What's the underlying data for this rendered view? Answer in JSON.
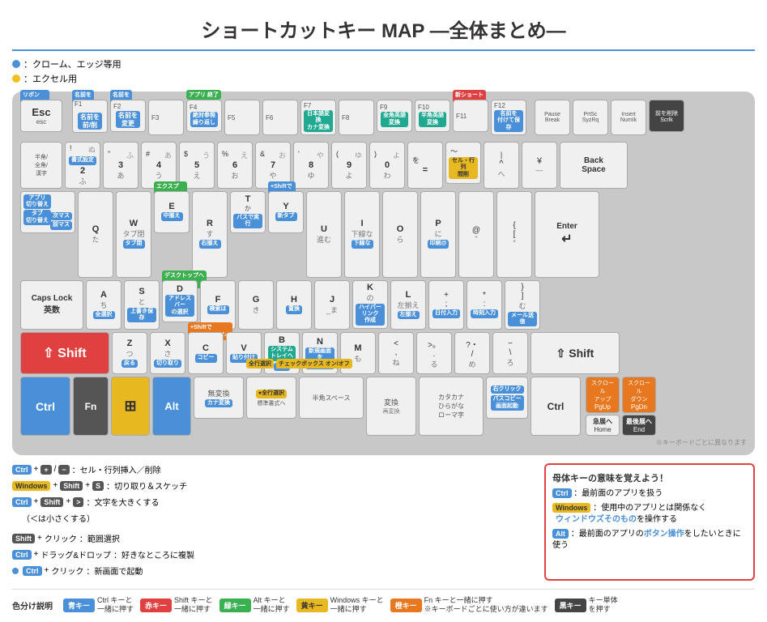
{
  "title": "ショートカットキー MAP ―全体まとめ―",
  "legend": {
    "blue": "：クローム、エッジ等用",
    "yellow": "：エクセル用"
  },
  "keyboard": {
    "note": "※キーボードごとに異なります"
  },
  "shortcuts": [
    {
      "keys": [
        "Ctrl",
        "+",
        "+",
        "/",
        "−"
      ],
      "desc": "：セル・行列挿入／削除"
    },
    {
      "keys": [
        "Windows",
        "+",
        "Shift",
        "+",
        "S"
      ],
      "desc": "：切り取り＆スケッチ"
    },
    {
      "keys": [
        "Ctrl",
        "+",
        "Shift",
        "+",
        ">"
      ],
      "desc": "：文字を大きくする（＜は小さくする）"
    },
    {
      "keys": [
        "Shift",
        "+",
        "クリック"
      ],
      "desc": "：範囲選択"
    },
    {
      "keys": [
        "Ctrl",
        "+",
        "ドラッグ&ドロップ"
      ],
      "desc": "：好きなところに複製"
    },
    {
      "keys": [
        "Ctrl",
        "+",
        "クリック"
      ],
      "desc": "：新画面で起動"
    }
  ],
  "infoBox": {
    "title": "母体キーの意味を覚えよう！",
    "rows": [
      {
        "key": "Ctrl",
        "keyColor": "blue",
        "desc": "：最前面のアプリを扱う"
      },
      {
        "key": "Windows",
        "keyColor": "yellow",
        "desc": "：使用中のアプリとは関係なくウィンドウズそのものを操作する"
      },
      {
        "key": "Alt",
        "keyColor": "blue",
        "desc": "：最前面のアプリのボタン操作をしたいときに使う"
      }
    ]
  },
  "colorLegend": [
    {
      "label": "色分け説明"
    },
    {
      "color": "#4a90d9",
      "name": "青キー",
      "desc": "Ctrl キーと\n一緒に押す"
    },
    {
      "color": "#e04040",
      "name": "赤キー",
      "desc": "Shift キーと\n一緒に押す"
    },
    {
      "color": "#3ab050",
      "name": "緑キー",
      "desc": "Alt キーと\n一緒に押す"
    },
    {
      "color": "#e8b820",
      "name": "黄キー",
      "desc": "Windows キーと\n一緒に押す",
      "textColor": "#333"
    },
    {
      "color": "#e87820",
      "name": "橙キー",
      "desc": "Fn キーと一緒に押す\n※キーボードごとに使い方が違います"
    },
    {
      "color": "#444",
      "name": "黒キー",
      "desc": "キー単体\nを押す"
    }
  ]
}
